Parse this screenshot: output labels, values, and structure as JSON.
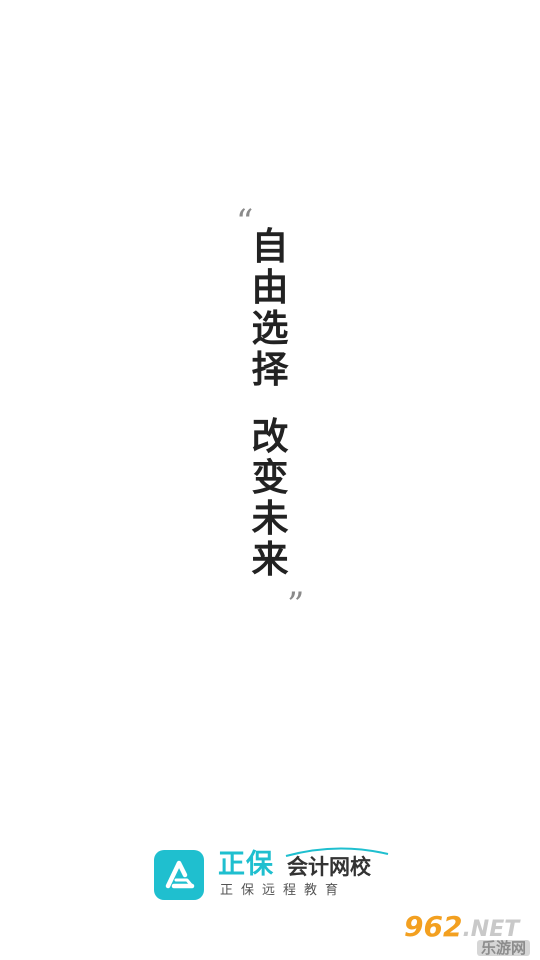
{
  "splash": {
    "quote_open": "“",
    "quote_close": "”",
    "slogan_line1": [
      "自",
      "由",
      "选",
      "择"
    ],
    "slogan_line2": [
      "改",
      "变",
      "未",
      "来"
    ]
  },
  "brand": {
    "name_primary": "正保",
    "name_secondary": "会计网校",
    "tagline": "正保远程教育",
    "logo_icon": "zhengbao-logo-icon",
    "accent_color": "#1fbfcf"
  },
  "watermark": {
    "number": "962",
    "suffix": ".NET",
    "site_name": "乐游网",
    "color": "#f3a020"
  }
}
